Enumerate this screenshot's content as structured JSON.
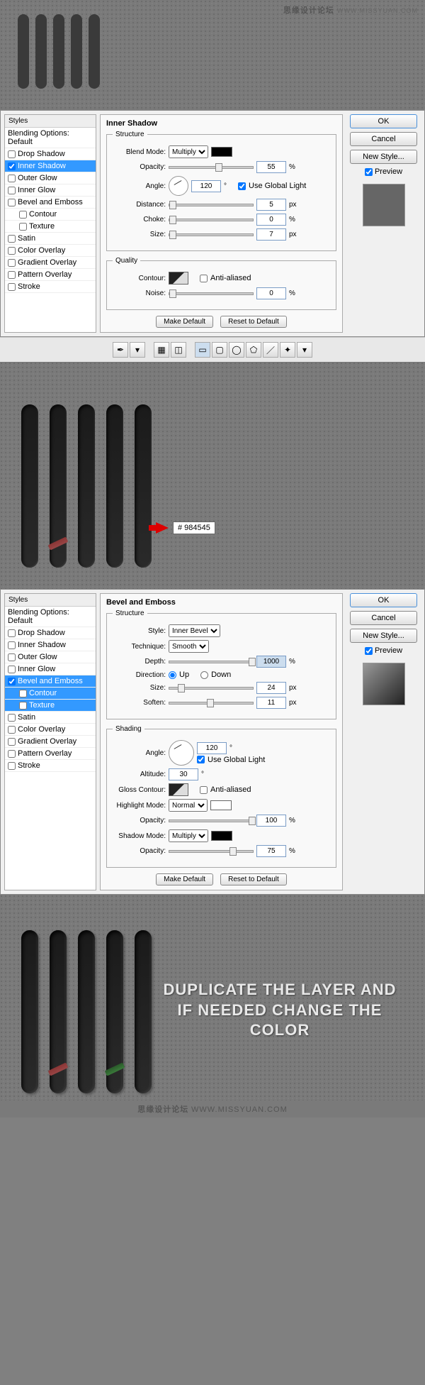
{
  "watermark": {
    "main": "思缘设计论坛",
    "sub": "WWW.MISSYUAN.COM"
  },
  "dialog1": {
    "title": "Inner Shadow",
    "styles_header": "Styles",
    "blending": "Blending Options: Default",
    "items": [
      {
        "label": "Drop Shadow"
      },
      {
        "label": "Inner Shadow"
      },
      {
        "label": "Outer Glow"
      },
      {
        "label": "Inner Glow"
      },
      {
        "label": "Bevel and Emboss"
      },
      {
        "label": "Contour"
      },
      {
        "label": "Texture"
      },
      {
        "label": "Satin"
      },
      {
        "label": "Color Overlay"
      },
      {
        "label": "Gradient Overlay"
      },
      {
        "label": "Pattern Overlay"
      },
      {
        "label": "Stroke"
      }
    ],
    "structure": "Structure",
    "blend_mode_lbl": "Blend Mode:",
    "blend_mode_val": "Multiply",
    "opacity_lbl": "Opacity:",
    "opacity_val": "55",
    "angle_lbl": "Angle:",
    "angle_val": "120",
    "angle_unit": "°",
    "global_light": "Use Global Light",
    "distance_lbl": "Distance:",
    "distance_val": "5",
    "choke_lbl": "Choke:",
    "choke_val": "0",
    "size_lbl": "Size:",
    "size_val": "7",
    "quality": "Quality",
    "contour_lbl": "Contour:",
    "antialiased": "Anti-aliased",
    "noise_lbl": "Noise:",
    "noise_val": "0",
    "make_default": "Make Default",
    "reset_default": "Reset to Default",
    "ok": "OK",
    "cancel": "Cancel",
    "newstyle": "New Style...",
    "preview": "Preview",
    "px": "px",
    "pct": "%"
  },
  "hex_label": "#  984545",
  "dialog2": {
    "title": "Bevel and Emboss",
    "structure": "Structure",
    "style_lbl": "Style:",
    "style_val": "Inner Bevel",
    "technique_lbl": "Technique:",
    "technique_val": "Smooth",
    "depth_lbl": "Depth:",
    "depth_val": "1000",
    "direction_lbl": "Direction:",
    "up": "Up",
    "down": "Down",
    "size_lbl": "Size:",
    "size_val": "24",
    "soften_lbl": "Soften:",
    "soften_val": "11",
    "shading": "Shading",
    "angle_lbl": "Angle:",
    "angle_val": "120",
    "global_light": "Use Global Light",
    "altitude_lbl": "Altitude:",
    "altitude_val": "30",
    "gloss_lbl": "Gloss Contour:",
    "antialiased": "Anti-aliased",
    "highlight_lbl": "Highlight Mode:",
    "highlight_val": "Normal",
    "opacity_lbl": "Opacity:",
    "h_opacity": "100",
    "shadow_lbl": "Shadow Mode:",
    "shadow_val": "Multiply",
    "s_opacity": "75",
    "px": "px",
    "pct": "%",
    "deg": "°"
  },
  "big_text": "DUPLICATE THE LAYER AND IF NEEDED CHANGE THE COLOR"
}
